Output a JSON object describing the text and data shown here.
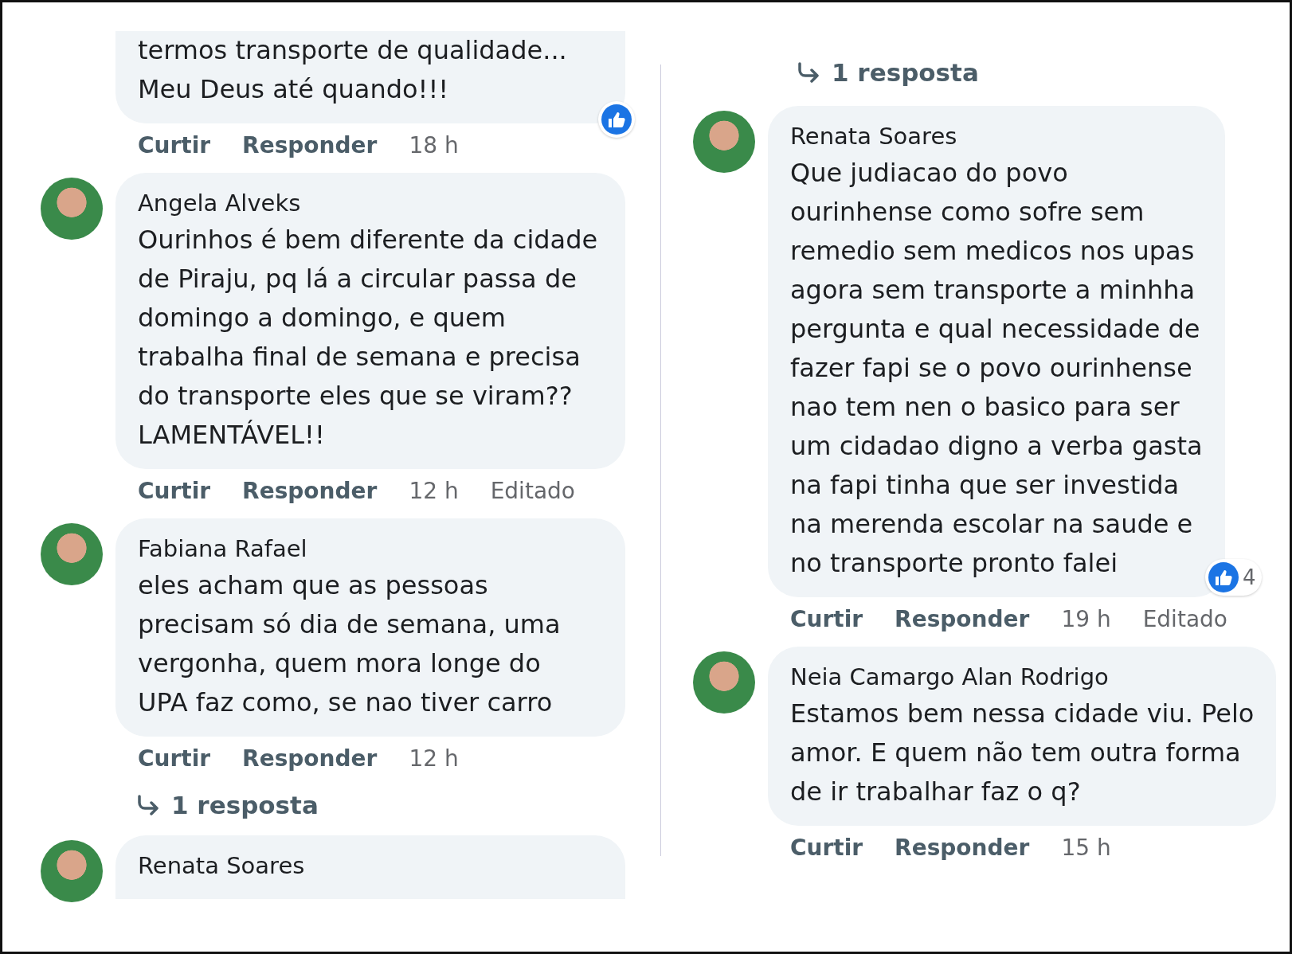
{
  "columns": [
    {
      "items": [
        {
          "kind": "comment",
          "avatar": false,
          "text": "termos transporte de qualidade...\nMeu Deus até quando!!!",
          "actions": [
            "Curtir",
            "Responder"
          ],
          "time": "18 h",
          "liked": true
        },
        {
          "kind": "comment",
          "avatar": true,
          "name": "Angela Alveks",
          "text": "Ourinhos é bem diferente da cidade\nde Piraju, pq lá a circular passa de\ndomingo a domingo, e quem\ntrabalha final de semana e precisa\ndo transporte eles que se viram??\nLAMENTÁVEL!!",
          "actions": [
            "Curtir",
            "Responder"
          ],
          "time": "12 h",
          "edited": "Editado"
        },
        {
          "kind": "comment",
          "avatar": true,
          "name": "Fabiana Rafael",
          "text": "eles acham que as pessoas\nprecisam só dia de semana, uma\nvergonha, quem mora longe do\nUPA faz como, se nao tiver carro",
          "actions": [
            "Curtir",
            "Responder"
          ],
          "time": "12 h"
        },
        {
          "kind": "replies",
          "label": "1 resposta"
        },
        {
          "kind": "comment",
          "avatar": true,
          "name": "Renata Soares"
        }
      ]
    },
    {
      "items": [
        {
          "kind": "replies",
          "label": "1 resposta"
        },
        {
          "kind": "comment",
          "avatar": true,
          "name": "Renata Soares",
          "text": "Que judiacao do povo\nourinhense como sofre sem\nremedio sem medicos nos upas\nagora sem transporte a minhha\npergunta e qual necessidade de\nfazer fapi se o povo ourinhense\nnao tem nen o basico para ser\num cidadao digno a verba gasta\nna fapi tinha que ser investida\nna merenda escolar na saude e\nno transporte pronto falei",
          "actions": [
            "Curtir",
            "Responder"
          ],
          "time": "19 h",
          "edited": "Editado",
          "liked": true,
          "reaction_count": "4"
        },
        {
          "kind": "comment",
          "avatar": true,
          "name": "Neia Camargo Alan Rodrigo",
          "text": "Estamos bem nessa cidade viu. Pelo\namor. E quem não tem outra forma\nde ir trabalhar faz o q?",
          "actions": [
            "Curtir",
            "Responder"
          ],
          "time": "15 h"
        }
      ]
    }
  ]
}
